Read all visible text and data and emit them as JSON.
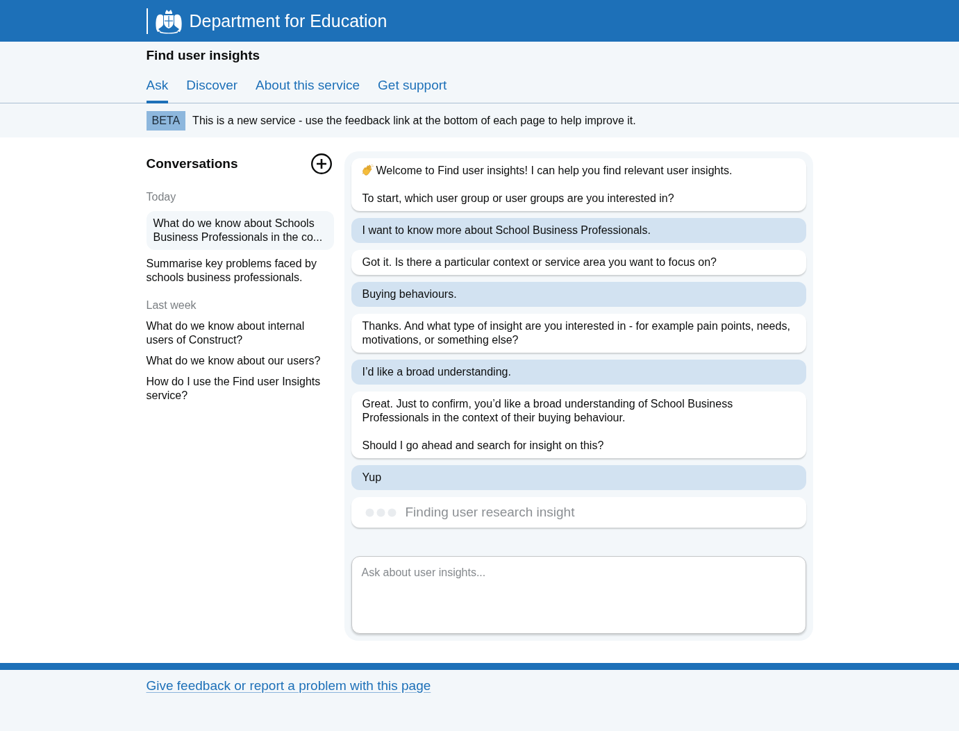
{
  "header": {
    "organisation": "Department for Education"
  },
  "service": {
    "name": "Find user insights"
  },
  "nav": {
    "tabs": [
      {
        "label": "Ask",
        "selected": true
      },
      {
        "label": "Discover",
        "selected": false
      },
      {
        "label": "About this service",
        "selected": false
      },
      {
        "label": "Get support",
        "selected": false
      }
    ]
  },
  "phase_banner": {
    "tag": "BETA",
    "text": "This is a new service - use the feedback link at the bottom of each page to help improve it."
  },
  "sidebar": {
    "title": "Conversations",
    "groups": [
      {
        "label": "Today",
        "items": [
          {
            "text": "What do we know about Schools Business Professionals in the co...",
            "selected": true
          },
          {
            "text": "Summarise key problems faced by schools business professionals.",
            "selected": false
          }
        ]
      },
      {
        "label": "Last week",
        "items": [
          {
            "text": "What do we know about internal users of Construct?",
            "selected": false
          },
          {
            "text": "What do we know about our users?",
            "selected": false
          },
          {
            "text": "How do I use the Find user Insights service?",
            "selected": false
          }
        ]
      }
    ]
  },
  "chat": {
    "messages": [
      {
        "kind": "bot",
        "greeting": true,
        "paragraphs": [
          "Welcome to Find user insights! I can help you find relevant user insights.",
          "To start, which user group or user groups are you interested in?"
        ]
      },
      {
        "kind": "user",
        "greeting": false,
        "paragraphs": [
          "I want to know more about School Business Professionals."
        ]
      },
      {
        "kind": "bot",
        "greeting": false,
        "paragraphs": [
          "Got it. Is there a particular context or service area you want to focus on?"
        ]
      },
      {
        "kind": "user",
        "greeting": false,
        "paragraphs": [
          "Buying behaviours."
        ]
      },
      {
        "kind": "bot",
        "greeting": false,
        "paragraphs": [
          "Thanks. And what type of insight are you interested in - for example pain points, needs, motivations, or something else?"
        ]
      },
      {
        "kind": "user",
        "greeting": false,
        "paragraphs": [
          "I’d like a broad understanding."
        ]
      },
      {
        "kind": "bot",
        "greeting": false,
        "paragraphs": [
          "Great. Just to confirm, you’d like a broad understanding of School Business Professionals in the context of their buying behaviour.",
          "Should I go ahead and search for insight on this?"
        ]
      },
      {
        "kind": "user",
        "greeting": false,
        "paragraphs": [
          "Yup"
        ]
      },
      {
        "kind": "loading",
        "greeting": false,
        "paragraphs": [
          "Finding user research insight"
        ]
      }
    ],
    "input": {
      "placeholder": "Ask about user insights..."
    }
  },
  "footer": {
    "link": "Give feedback or report a problem with this page"
  }
}
